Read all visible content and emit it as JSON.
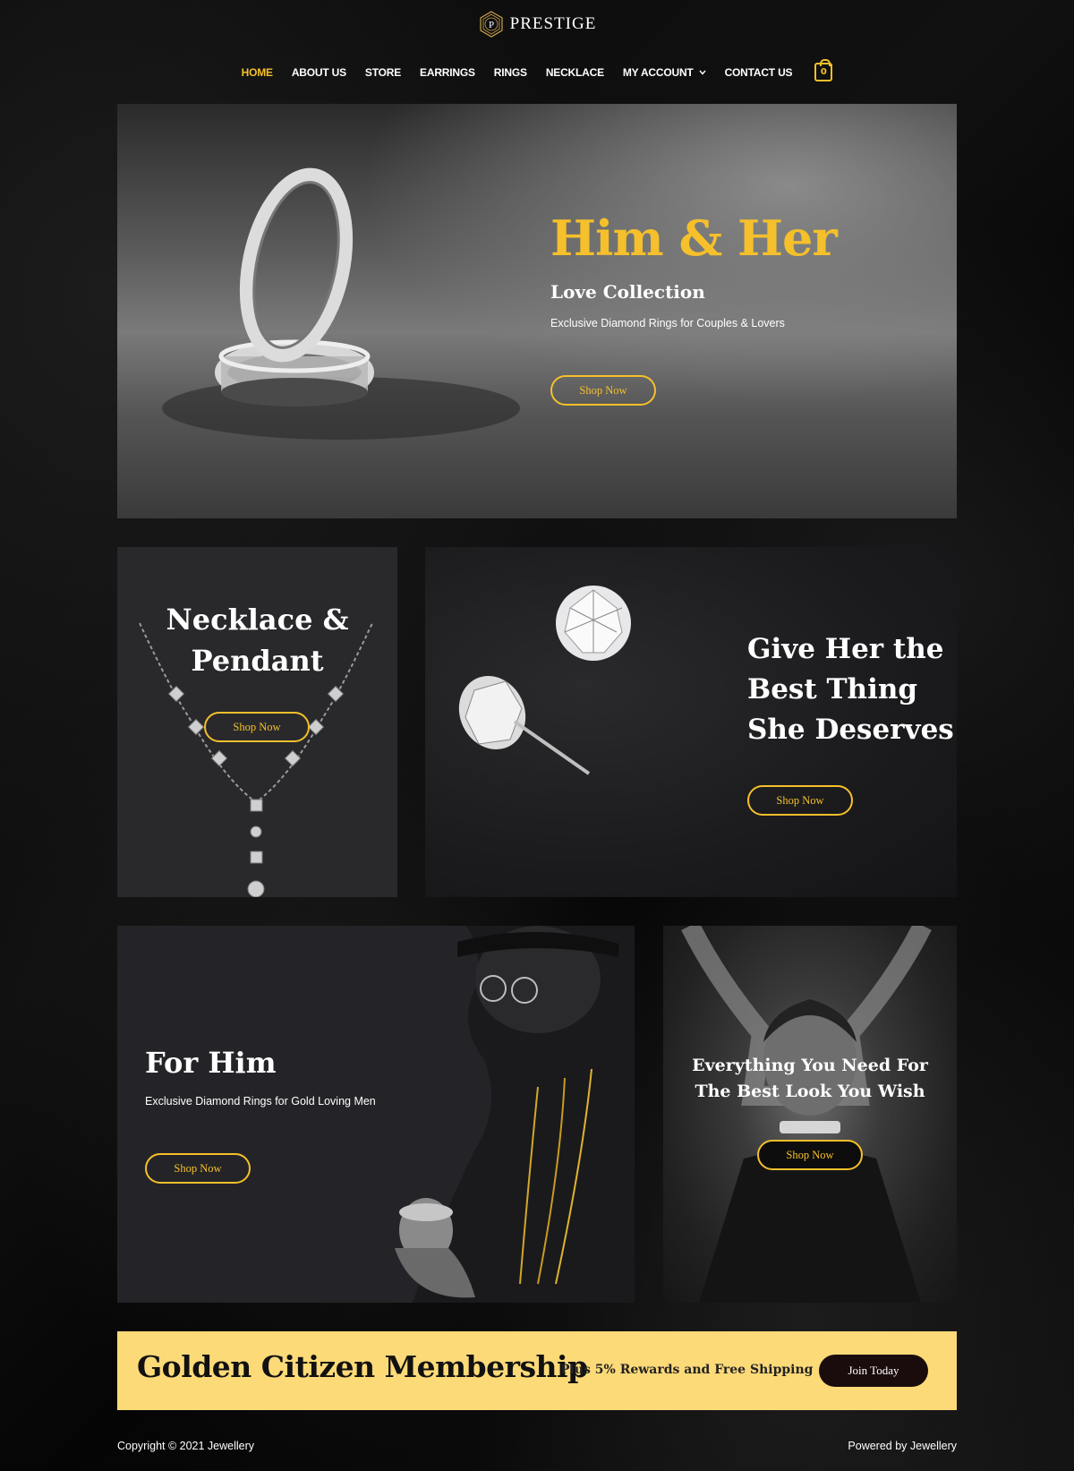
{
  "brand": {
    "name": "PRESTIGE",
    "monogram": "P",
    "logo_icon": "hexagon-monogram-icon"
  },
  "nav": {
    "items": [
      {
        "label": "HOME",
        "active": true
      },
      {
        "label": "ABOUT US"
      },
      {
        "label": "STORE"
      },
      {
        "label": "EARRINGS"
      },
      {
        "label": "RINGS"
      },
      {
        "label": "NECKLACE"
      },
      {
        "label": "MY ACCOUNT",
        "icon": "chevron-down-icon"
      },
      {
        "label": "CONTACT US"
      }
    ],
    "cart_count": "0"
  },
  "hero": {
    "title": "Him & Her",
    "subtitle": "Love Collection",
    "description": "Exclusive Diamond Rings for Couples & Lovers",
    "button": "Shop Now"
  },
  "necklace": {
    "title_line1": "Necklace &",
    "title_line2": "Pendant",
    "button": "Shop Now"
  },
  "earring": {
    "line1": "Give Her the",
    "line2": "Best Thing",
    "line3": "She Deserves",
    "button": "Shop Now"
  },
  "forhim": {
    "title": "For Him",
    "description": "Exclusive Diamond Rings for Gold Loving Men",
    "button": "Shop Now"
  },
  "woman": {
    "line1": "Everything You Need For",
    "line2": "The Best Look You Wish",
    "button": "Shop Now"
  },
  "membership": {
    "title": "Golden Citizen Membership",
    "subtitle": "Plus 5% Rewards and Free Shipping",
    "button": "Join Today"
  },
  "footer": {
    "copyright": "Copyright © 2021 Jewellery",
    "powered": "Powered by Jewellery"
  },
  "colors": {
    "accent": "#f5c02b",
    "membership_bg": "#fdda78",
    "panel_dark": "#29292c"
  }
}
